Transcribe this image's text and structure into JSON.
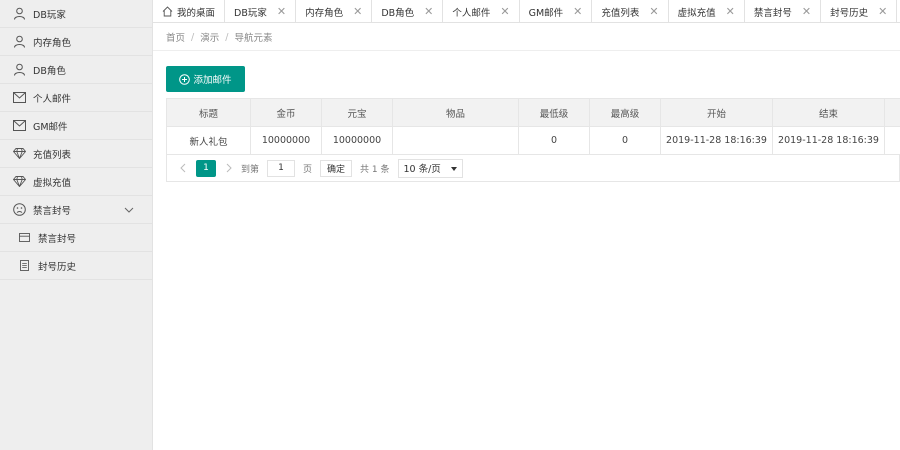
{
  "sidebar": {
    "items": [
      {
        "label": "DB玩家",
        "icon": "user-icon"
      },
      {
        "label": "内存角色",
        "icon": "user-icon"
      },
      {
        "label": "DB角色",
        "icon": "user-icon"
      },
      {
        "label": "个人邮件",
        "icon": "mail-icon"
      },
      {
        "label": "GM邮件",
        "icon": "mail-icon"
      },
      {
        "label": "充值列表",
        "icon": "diamond-icon"
      },
      {
        "label": "虚拟充值",
        "icon": "diamond-icon"
      },
      {
        "label": "禁言封号",
        "icon": "sad-face-icon"
      }
    ],
    "subitems": [
      {
        "label": "禁言封号",
        "icon": "card-icon"
      },
      {
        "label": "封号历史",
        "icon": "document-icon"
      }
    ]
  },
  "tabs": [
    {
      "label": "我的桌面"
    },
    {
      "label": "DB玩家"
    },
    {
      "label": "内存角色"
    },
    {
      "label": "DB角色"
    },
    {
      "label": "个人邮件"
    },
    {
      "label": "GM邮件"
    },
    {
      "label": "充值列表"
    },
    {
      "label": "虚拟充值"
    },
    {
      "label": "禁言封号"
    },
    {
      "label": "封号历史"
    }
  ],
  "tab_close_glyph": "✕",
  "breadcrumb": [
    "首页",
    "演示",
    "导航元素"
  ],
  "breadcrumb_sep": "/",
  "add_button": "添加邮件",
  "table": {
    "headers": [
      "标题",
      "金币",
      "元宝",
      "物品",
      "最低级",
      "最高级",
      "开始",
      "结束",
      ""
    ],
    "rows": [
      [
        "新人礼包",
        "10000000",
        "10000000",
        "",
        "0",
        "0",
        "2019-11-28 18:16:39",
        "2019-11-28 18:16:39",
        ""
      ]
    ]
  },
  "pager": {
    "current_page": "1",
    "goto_label": "到第",
    "goto_value": "1",
    "page_unit": "页",
    "confirm": "确定",
    "total": "共 1 条",
    "page_size": "10 条/页"
  },
  "colors": {
    "accent": "#009688",
    "sidebar_bg": "#eeeeee"
  }
}
